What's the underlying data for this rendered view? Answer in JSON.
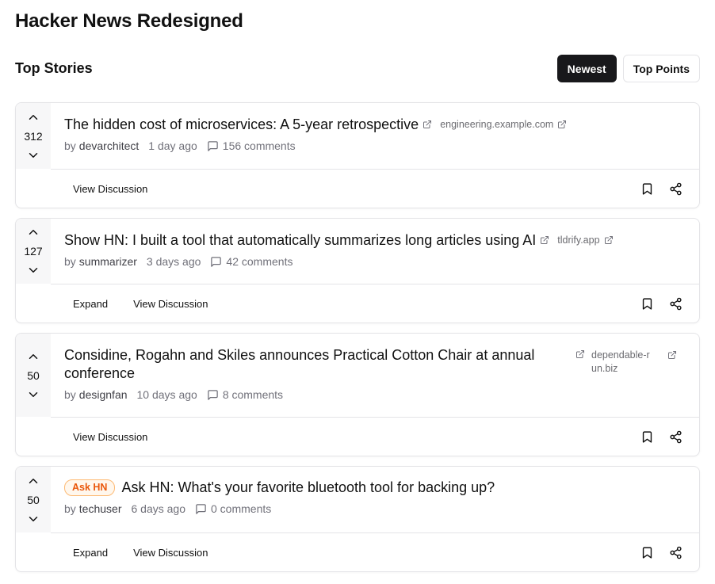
{
  "app": {
    "title": "Hacker News Redesigned"
  },
  "section": {
    "title": "Top Stories"
  },
  "sort": {
    "newest_label": "Newest",
    "top_points_label": "Top Points",
    "active": "newest"
  },
  "colors": {
    "accent_dark": "#18181b",
    "badge_orange": "#ea580c",
    "border": "#e4e4e7"
  },
  "icons": {
    "upvote": "chevron-up-icon",
    "downvote": "chevron-down-icon",
    "external": "external-link-icon",
    "comment": "comment-icon",
    "bookmark": "bookmark-icon",
    "share": "share-icon"
  },
  "stories": [
    {
      "points": "312",
      "title": "The hidden cost of microservices: A 5-year retrospective",
      "domain": "engineering.example.com",
      "by": "by",
      "author": "devarchitect",
      "age": "1 day ago",
      "comments": "156 comments",
      "actions": [
        "View Discussion"
      ]
    },
    {
      "points": "127",
      "title": "Show HN: I built a tool that automatically summarizes long articles using AI",
      "domain": "tldrify.app",
      "by": "by",
      "author": "summarizer",
      "age": "3 days ago",
      "comments": "42 comments",
      "actions": [
        "Expand",
        "View Discussion"
      ]
    },
    {
      "points": "50",
      "title": "Considine, Rogahn and Skiles announces Practical Cotton Chair at annual conference",
      "domain": "dependable-run.biz",
      "by": "by",
      "author": "designfan",
      "age": "10 days ago",
      "comments": "8 comments",
      "actions": [
        "View Discussion"
      ]
    },
    {
      "points": "50",
      "badge": "Ask HN",
      "title": "Ask HN: What's your favorite bluetooth tool for backing up?",
      "by": "by",
      "author": "techuser",
      "age": "6 days ago",
      "comments": "0 comments",
      "actions": [
        "Expand",
        "View Discussion"
      ]
    }
  ]
}
